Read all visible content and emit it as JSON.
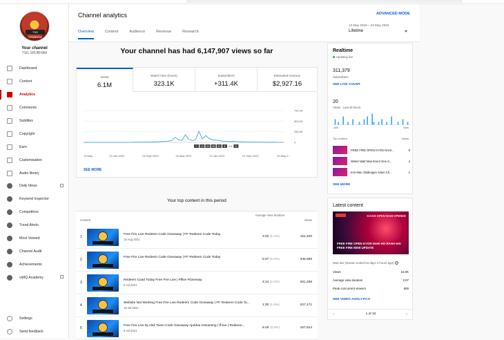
{
  "sidebar": {
    "channel_label": "Your channel",
    "channel_name": "TSG SHUBHAM",
    "avatar_text": "TSG SHUBHAM",
    "items": [
      {
        "label": "Dashboard",
        "icon": "dashboard-icon"
      },
      {
        "label": "Content",
        "icon": "content-icon"
      },
      {
        "label": "Analytics",
        "icon": "analytics-icon",
        "active": true
      },
      {
        "label": "Comments",
        "icon": "comments-icon"
      },
      {
        "label": "Subtitles",
        "icon": "subtitles-icon"
      },
      {
        "label": "Copyright",
        "icon": "copyright-icon"
      },
      {
        "label": "Earn",
        "icon": "earn-icon"
      },
      {
        "label": "Customisation",
        "icon": "customisation-icon"
      },
      {
        "label": "Audio library",
        "icon": "audio-library-icon"
      },
      {
        "label": "Daily Ideas",
        "icon": "vidiq-icon",
        "external": true
      },
      {
        "label": "Keyword Inspector",
        "icon": "vidiq-icon"
      },
      {
        "label": "Competitors",
        "icon": "vidiq-icon"
      },
      {
        "label": "Trend Alerts",
        "icon": "vidiq-icon"
      },
      {
        "label": "Most Viewed",
        "icon": "vidiq-icon"
      },
      {
        "label": "Channel Audit",
        "icon": "vidiq-icon"
      },
      {
        "label": "Achievements",
        "icon": "vidiq-icon"
      },
      {
        "label": "vidIQ Academy",
        "icon": "vidiq-icon",
        "external": true
      }
    ],
    "bottom": [
      {
        "label": "Settings",
        "icon": "settings-icon"
      },
      {
        "label": "Send feedback",
        "icon": "feedback-icon"
      }
    ]
  },
  "header": {
    "title": "Channel analytics",
    "advanced_mode": "ADVANCED MODE",
    "tabs": [
      "Overview",
      "Content",
      "Audience",
      "Revenue",
      "Research"
    ],
    "date_range": "13 May 2019 – 23 May 2023",
    "period": "Lifetime"
  },
  "overview": {
    "headline": "Your channel has had 6,147,907 views so far",
    "metrics": [
      {
        "label": "Views",
        "value": "6.1M"
      },
      {
        "label": "Watch time (hours)",
        "value": "323.1K"
      },
      {
        "label": "Subscribers",
        "value": "+311.4K"
      },
      {
        "label": "Estimated revenue",
        "value": "$2,927.16"
      }
    ],
    "see_more": "SEE MORE"
  },
  "chart_data": {
    "type": "line",
    "x": [
      "13 May ...",
      "13 Jan 2020",
      "14 Sept 2020",
      "18 May 2021",
      "13 Jan 2022",
      "20 Sept 2022",
      "23 May 2..."
    ],
    "y_ticks": [
      "750.0K",
      "500.0K",
      "250.0K",
      "0"
    ],
    "ylim": [
      0,
      750000
    ],
    "series": [
      {
        "values": [
          0,
          0,
          0,
          0,
          0,
          0,
          0,
          0,
          0,
          0,
          0,
          0,
          0,
          0,
          2000,
          4000,
          3000,
          5000,
          6000,
          8000,
          9000,
          12000,
          15000,
          20000,
          25000,
          30000,
          40000,
          120000,
          60000,
          45000,
          180000,
          70000,
          40000,
          60000,
          260000,
          80000,
          160000,
          90000,
          60000,
          50000,
          40000,
          30000,
          25000,
          20000,
          22000,
          18000,
          15000,
          12000,
          10000,
          9000,
          8000,
          7000,
          6000,
          5000,
          4000,
          3000,
          3000,
          2000,
          2000,
          2000
        ]
      }
    ],
    "markers": [
      "7",
      "12",
      "22",
      "28",
      "31",
      "8",
      "6~8",
      "5"
    ]
  },
  "top_content": {
    "title": "Your top content in this period",
    "col_content": "Content",
    "col_avd": "Average view duration",
    "col_views": "Views",
    "rows": [
      {
        "idx": "1",
        "title": "Free Fire Live Redeem Code Giveaway | FF Redeem Code Today",
        "date": "15 Aug 2021",
        "avd": "2:32",
        "pct": "(1.2%)",
        "views": "311,420"
      },
      {
        "idx": "2",
        "title": "Free Fire Live Redeem Code Giveaway | FF Redeem Code Today",
        "date": "",
        "avd": "5:47",
        "pct": "(5.4%)",
        "views": "345,559"
      },
      {
        "idx": "3",
        "title": "Redeem Coad Today Free Fire Live | #ffive #Giveway",
        "date": "5 Jul 2021",
        "avd": "4:14",
        "pct": "(2.4%)",
        "views": "261,338"
      },
      {
        "idx": "4",
        "title": "Website Not Working Free Fire Live Redeem Code Giveaway | FF Redeem Code To...",
        "date": "19 Jul 2021",
        "avd": "1:30",
        "pct": "(1.6%)",
        "views": "227,171"
      },
      {
        "idx": "5",
        "title": "Free Fire Live Dj Alok Team Code Giveaway Ajubhai AsGaming | ff live | Redeem...",
        "date": "9 Jul 2021",
        "avd": "6:18",
        "pct": "(3.3%)",
        "views": "157,514"
      }
    ]
  },
  "realtime": {
    "title": "Realtime",
    "status": "Updating live",
    "subscribers": "311,379",
    "subscribers_label": "Subscribers",
    "see_live": "SEE LIVE COUNT",
    "views48": "20",
    "views48_label": "Views · Last 48 hours",
    "bars": [
      0,
      2,
      0,
      1,
      0,
      0,
      3,
      0,
      0,
      1,
      0,
      0,
      2,
      0,
      0,
      0,
      1,
      0,
      0,
      2,
      0,
      3,
      0,
      0,
      4,
      1,
      0,
      0,
      1,
      0,
      2,
      0,
      0,
      1,
      0,
      0,
      3,
      0,
      0,
      0,
      1,
      0,
      0,
      2,
      0,
      0,
      1,
      0
    ],
    "axis_left": "-48h",
    "axis_right": "Now",
    "top_label": "Top content",
    "top_views_label": "Views",
    "top": [
      {
        "title": "FREE FIRE OPEN KYON NAHI...",
        "views": "8"
      },
      {
        "title": "Winter Walt New Event One S...",
        "views": "4"
      },
      {
        "title": "Iron Man challenges Adam Ch...",
        "views": "1"
      }
    ],
    "see_more": "SEE MORE"
  },
  "latest": {
    "title": "Latest content",
    "thumb_caption": "FREE FIRE OPEN KYON NAHI HO RAHA HAI FREE FIRE NEW UPDATE",
    "thumb_banner": "KAADI OPEN NAHI OPENED",
    "streamed": "Was live (stream ended 53 days 3 hours ago)",
    "stats": [
      {
        "label": "Views",
        "value": "16.0K"
      },
      {
        "label": "Average view duration",
        "value": "2:07"
      },
      {
        "label": "Peak concurrent viewers",
        "value": "659"
      }
    ],
    "see_analytics": "SEE VIDEO ANALYTICS",
    "pager": "1 of 10"
  }
}
